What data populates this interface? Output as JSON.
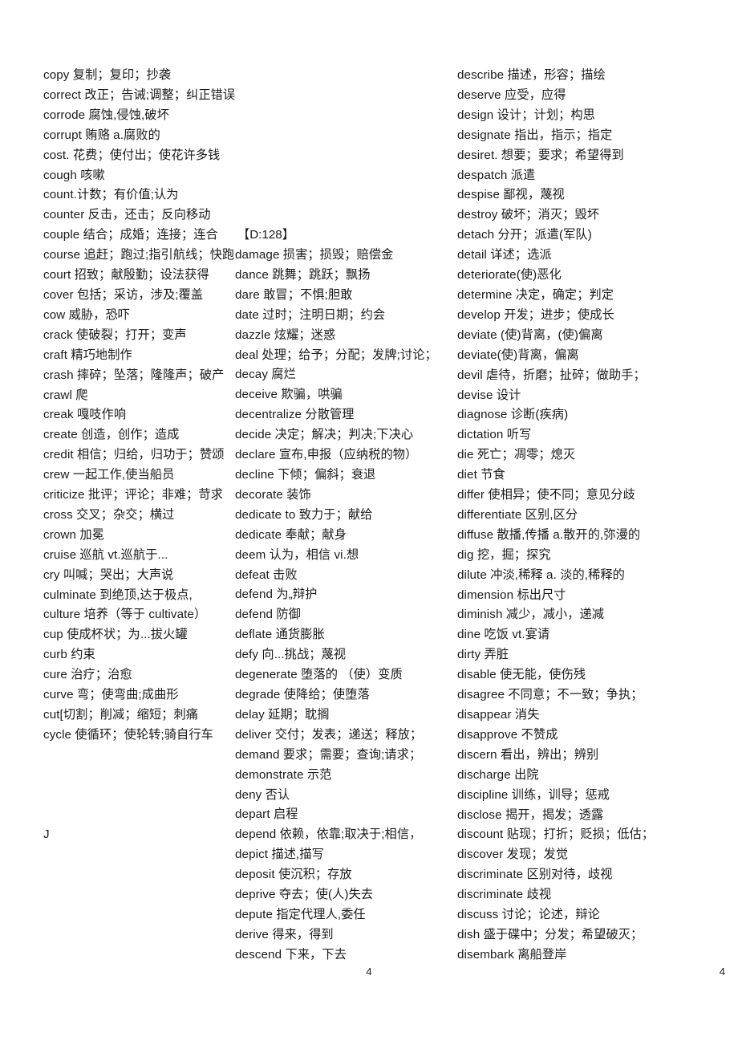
{
  "document": {
    "page_number": "4",
    "page_number_right": "4",
    "lone_letter": "J"
  },
  "columns": {
    "col1": {
      "entries": [
        "copy 复制；复印；抄袭",
        "correct 改正；告诫;调整；纠正错误",
        "corrode 腐蚀,侵蚀,破坏",
        "corrupt 贿赂  a.腐败的",
        "cost.  花费；使付出；使花许多钱",
        "cough 咳嗽",
        "count.计数；有价值;认为",
        "counter 反击，还击；反向移动",
        "couple 结合；成婚；连接；连合",
        "course 追赶；跑过;指引航线；快跑",
        "court 招致；献殷勤；设法获得",
        "cover 包括；采访，涉及;覆盖",
        "cow 威胁，恐吓",
        "crack  使破裂；打开；变声",
        "craft  精巧地制作",
        "crash 摔碎；坠落；隆隆声；破产",
        "crawl 爬",
        "creak 嘎吱作响",
        "create 创造，创作；造成",
        "credit 相信；归给，归功于；赞颂",
        "crew 一起工作,使当船员",
        "criticize 批评；评论；非难；苛求",
        "cross 交叉；杂交；横过",
        "crown 加冕",
        "cruise 巡航  vt.巡航于...",
        "cry 叫喊；哭出；大声说",
        "culminate 到绝顶,达于极点,",
        "culture 培养（等于 cultivate）",
        "cup 使成杯状；为...拔火罐",
        "curb 约束",
        "cure 治疗；治愈",
        "curve 弯；使弯曲;成曲形",
        "cut[切割；削减；缩短；刺痛",
        "cycle 使循环；使轮转;骑自行车"
      ]
    },
    "col2": {
      "section_header": "【D:128】",
      "entries": [
        "damage  损害；损毁；赔偿金",
        "dance  跳舞；跳跃；飘扬",
        "dare  敢冒；不惧;胆敢",
        "date 过时；注明日期；约会",
        "dazzle 炫耀；迷惑",
        "deal  处理；给予；分配；发牌;讨论；",
        "decay 腐烂",
        "deceive 欺骗，哄骗",
        "decentralize 分散管理",
        "decide  决定；解决；判决;下决心",
        "declare 宣布,申报（应纳税的物）",
        "decline 下倾；偏斜；衰退",
        "decorate 装饰",
        "dedicate    to 致力于；献给",
        "dedicate 奉献；献身",
        "deem 认为，相信 vi.想",
        "defeat 击败",
        "defend 为„辩护",
        "defend 防御",
        "deflate 通货膨胀",
        "defy 向...挑战；蔑视",
        "degenerate 堕落的 （使）变质",
        "degrade 使降给；使堕落",
        "delay 延期；耽搁",
        "deliver 交付；发表；递送；释放；",
        "demand  要求；需要；查询;请求；",
        "demonstrate 示范",
        "deny 否认",
        "depart 启程",
        "depend 依赖，依靠;取决于;相信，",
        "depict 描述,描写",
        "deposit 使沉积；存放",
        "deprive 夺去；使(人)失去",
        "depute 指定代理人,委任",
        "derive 得来，得到",
        "descend 下来，下去"
      ]
    },
    "col3": {
      "entries": [
        "describe 描述，形容；描绘",
        "deserve  应受，应得",
        "design 设计；计划；构思",
        "designate 指出，指示；指定",
        "desiret. 想要；要求；希望得到",
        "despatch 派遣",
        "despise 鄙视，蔑视",
        "destroy 破坏；消灭；毁坏",
        "detach 分开；派遣(军队)",
        "detail  详述；选派",
        "deteriorate(使)恶化",
        "determine 决定，确定；判定",
        "develop 开发；进步；使成长",
        "deviate (使)背离，(使)偏离",
        "deviate(使)背离，偏离",
        "devil  虐待，折磨；扯碎；做助手；",
        "devise 设计",
        "diagnose 诊断(疾病)",
        "dictation 听写",
        "die 死亡；凋零；熄灭",
        "diet 节食",
        "differ 使相异；使不同；意见分歧",
        "differentiate  区别,区分",
        "diffuse 散播,传播  a.散开的,弥漫的",
        "dig  挖，掘；探究",
        "dilute 冲淡,稀释  a. 淡的,稀释的",
        "dimension 标出尺寸",
        "diminish 减少，减小，递减",
        "dine 吃饭  vt.宴请",
        "dirty 弄脏",
        "disable 使无能，使伤残",
        "disagree 不同意；不一致；争执；",
        "disappear 消失",
        "disapprove 不赞成",
        "discern 看出，辨出；辨别",
        "discharge 出院",
        "discipline 训练，训导；惩戒",
        "disclose 揭开，揭发；透露",
        "discount 贴现；打折；贬损；低估；",
        "discover 发现；发觉",
        "discriminate 区别对待，歧视",
        "discriminate 歧视",
        "discuss 讨论；论述，辩论",
        "dish 盛于碟中；分发；希望破灭；",
        "disembark 离船登岸"
      ]
    }
  }
}
